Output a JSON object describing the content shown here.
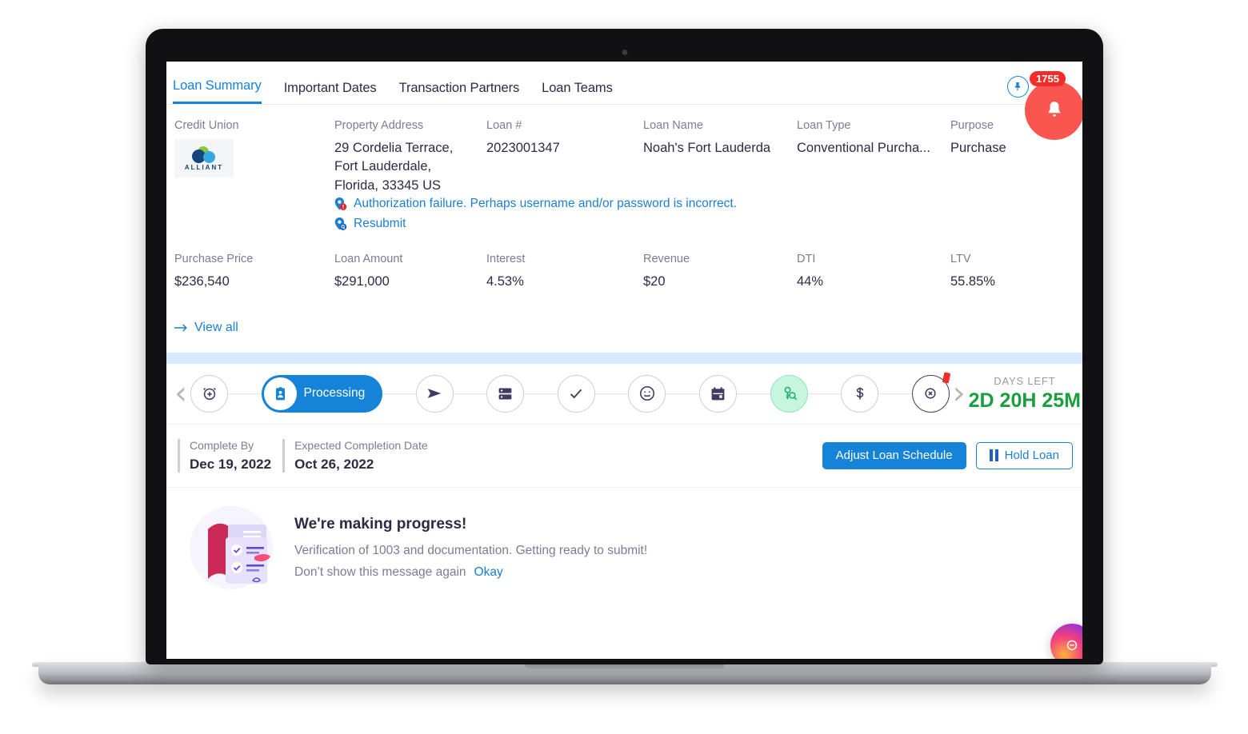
{
  "tabs": [
    {
      "label": "Loan Summary",
      "active": true
    },
    {
      "label": "Important Dates",
      "active": false
    },
    {
      "label": "Transaction Partners",
      "active": false
    },
    {
      "label": "Loan Teams",
      "active": false
    }
  ],
  "header_actions": {
    "pin_icon": "pin-icon",
    "document_icon": "document-icon",
    "bell_icon": "bell-icon",
    "bell_count": "1755"
  },
  "summary": {
    "fields": [
      {
        "label": "Credit Union",
        "value": ""
      },
      {
        "label": "Property Address",
        "value": "29 Cordelia Terrace, Fort Lauderdale, Florida, 33345 US"
      },
      {
        "label": "Loan #",
        "value": "2023001347"
      },
      {
        "label": "Loan Name",
        "value": "Noah's Fort Lauderda"
      },
      {
        "label": "Loan Type",
        "value": "Conventional Purcha..."
      },
      {
        "label": "Purpose",
        "value": "Purchase"
      }
    ],
    "credit_union_logo_text": "ALLIANT",
    "alerts": [
      {
        "icon": "map-pin-error-icon",
        "text": "Authorization failure.  Perhaps username and/or password is incorrect."
      },
      {
        "icon": "map-pin-search-icon",
        "text": "Resubmit"
      }
    ],
    "metrics": [
      {
        "label": "Purchase Price",
        "value": "$236,540"
      },
      {
        "label": "Loan Amount",
        "value": "$291,000"
      },
      {
        "label": "Interest",
        "value": "4.53%"
      },
      {
        "label": "Revenue",
        "value": "$20"
      },
      {
        "label": "DTI",
        "value": "44%"
      },
      {
        "label": "LTV",
        "value": "55.85%"
      }
    ],
    "view_all": "View all"
  },
  "stepper": {
    "prev_label": "‹",
    "next_label": "›",
    "steps": [
      {
        "icon": "alarm-clock-plus-icon",
        "label": "",
        "state": "default"
      },
      {
        "icon": "id-badge-icon",
        "label": "Processing",
        "state": "active"
      },
      {
        "icon": "send-icon",
        "label": "",
        "state": "default"
      },
      {
        "icon": "server-list-icon",
        "label": "",
        "state": "default"
      },
      {
        "icon": "check-icon",
        "label": "",
        "state": "default"
      },
      {
        "icon": "smiley-icon",
        "label": "",
        "state": "default"
      },
      {
        "icon": "calendar-icon",
        "label": "",
        "state": "default"
      },
      {
        "icon": "keys-icon",
        "label": "",
        "state": "highlighted"
      },
      {
        "icon": "dollar-icon",
        "label": "",
        "state": "default"
      },
      {
        "icon": "x-circle-icon",
        "label": "",
        "state": "progress"
      }
    ],
    "days_left_label": "DAYS LEFT",
    "days_left_value": "2D 20H 25M"
  },
  "dates": {
    "complete_by_label": "Complete By",
    "complete_by_value": "Dec 19, 2022",
    "expected_label": "Expected Completion Date",
    "expected_value": "Oct 26, 2022"
  },
  "actions": {
    "adjust_label": "Adjust Loan Schedule",
    "hold_label": "Hold Loan",
    "hold_icon": "pause-icon"
  },
  "message": {
    "title": "We're making progress!",
    "body": "Verification of 1003 and documentation. Getting ready to submit!",
    "dont_show": "Don’t show this message again",
    "okay": "Okay",
    "illustration": "checklist-document-illustration"
  },
  "fab": {
    "icon": "assistant-icon"
  },
  "colors": {
    "accent_blue": "#1483d8",
    "text_dark": "#2d2a45",
    "text_muted": "#7e7b96",
    "green": "#18a03c",
    "step_green": "#c8f5de",
    "alert_red": "#f02d28",
    "band_blue": "#d7ecfb"
  }
}
